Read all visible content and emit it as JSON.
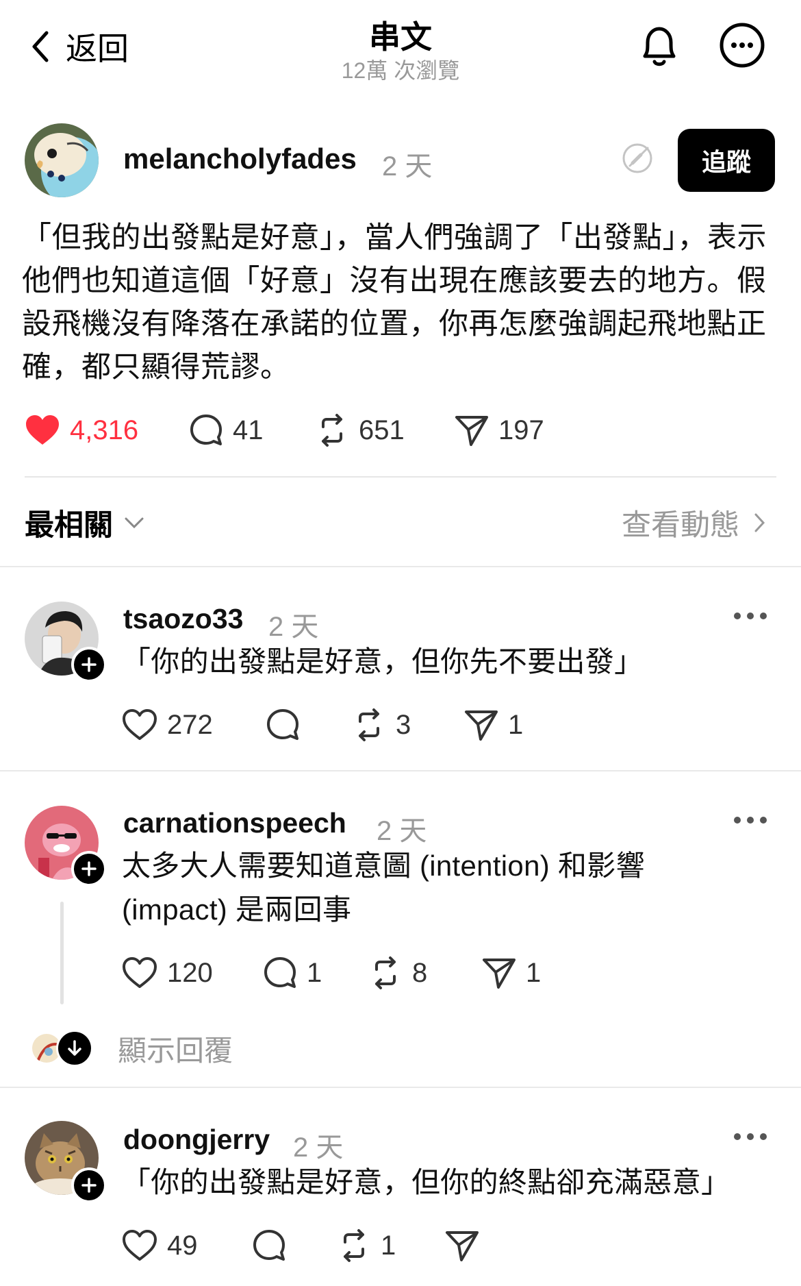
{
  "header": {
    "back_label": "返回",
    "title": "串文",
    "subtitle": "12萬 次瀏覽"
  },
  "post": {
    "username": "melancholyfades",
    "time": "2 天",
    "follow_label": "追蹤",
    "body": "「但我的出發點是好意」，當人們強調了「出發點」，表示他們也知道這個「好意」沒有出現在應該要去的地方。假設飛機沒有降落在承諾的位置，你再怎麼強調起飛地點正確，都只顯得荒謬。",
    "likes": "4,316",
    "replies": "41",
    "reposts": "651",
    "shares": "197"
  },
  "sort": {
    "label": "最相關",
    "activity_label": "查看動態"
  },
  "replies": [
    {
      "username": "tsaozo33",
      "time": "2 天",
      "text": "「你的出發點是好意，但你先不要出發」",
      "likes": "272",
      "replies": "",
      "reposts": "3",
      "shares": "1"
    },
    {
      "username": "carnationspeech",
      "time": "2 天",
      "text": "太多大人需要知道意圖 (intention) 和影響 (impact) 是兩回事",
      "likes": "120",
      "replies": "1",
      "reposts": "8",
      "shares": "1"
    },
    {
      "username": "doongjerry",
      "time": "2 天",
      "text": "「你的出發點是好意，但你的終點卻充滿惡意」",
      "likes": "49",
      "replies": "",
      "reposts": "1",
      "shares": ""
    }
  ],
  "show_replies_label": "顯示回覆",
  "colors": {
    "like_red": "#ff3040",
    "muted_gray": "#999999",
    "text": "#111111"
  },
  "icons": [
    "chevron-left-icon",
    "bell-icon",
    "more-circle-icon",
    "edit-off-icon",
    "heart-filled-icon",
    "heart-icon",
    "comment-icon",
    "repost-icon",
    "share-icon",
    "chevron-down-icon",
    "chevron-right-icon",
    "plus-icon",
    "arrow-down-icon",
    "more-dots-icon"
  ]
}
